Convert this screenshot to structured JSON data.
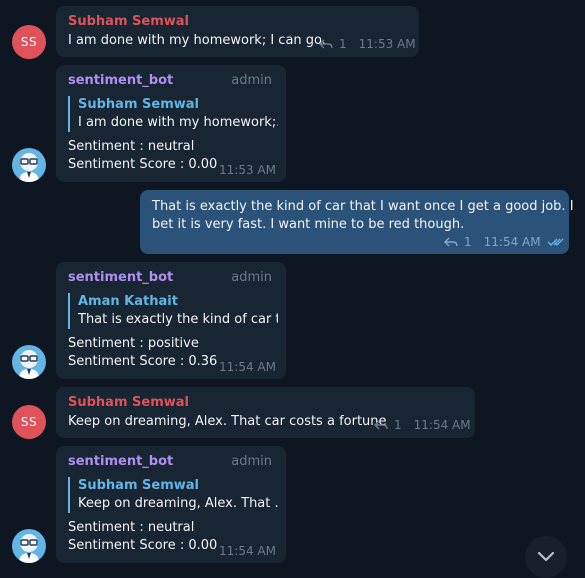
{
  "messages": [
    {
      "sender": "Subham Semwal",
      "avatar": "SS",
      "text": "I am done with my homework; I can go.",
      "replies": "1",
      "time": "11:53 AM"
    },
    {
      "sender": "sentiment_bot",
      "role": "admin",
      "reply_to_name": "Subham Semwal",
      "reply_to_text": "I am done with my homework;...",
      "line1": "Sentiment : neutral",
      "line2": "Sentiment Score :  0.00",
      "time": "11:53 AM"
    },
    {
      "text_line1": "That is exactly the kind of car that I want once I get a good job. I",
      "text_line2": "bet it is very fast. I want mine to be red though.",
      "replies": "1",
      "time": "11:54 AM"
    },
    {
      "sender": "sentiment_bot",
      "role": "admin",
      "reply_to_name": "Aman Kathait",
      "reply_to_text": "That is exactly the kind of car t...",
      "line1": "Sentiment : positive",
      "line2": "Sentiment Score :  0.36",
      "time": "11:54 AM"
    },
    {
      "sender": "Subham Semwal",
      "avatar": "SS",
      "text": "Keep on dreaming, Alex. That car costs a fortune",
      "replies": "1",
      "time": "11:54 AM"
    },
    {
      "sender": "sentiment_bot",
      "role": "admin",
      "reply_to_name": "Subham Semwal",
      "reply_to_text": "Keep on dreaming, Alex. That ...",
      "line1": "Sentiment : neutral",
      "line2": "Sentiment Score :  0.00",
      "time": "11:54 AM"
    }
  ],
  "colors": {
    "background": "#0e1621",
    "bubble_in": "#182533",
    "bubble_out": "#2b5278",
    "accent": "#62b5e5",
    "user_name": "#e0525a",
    "bot_name": "#b18ef2"
  }
}
